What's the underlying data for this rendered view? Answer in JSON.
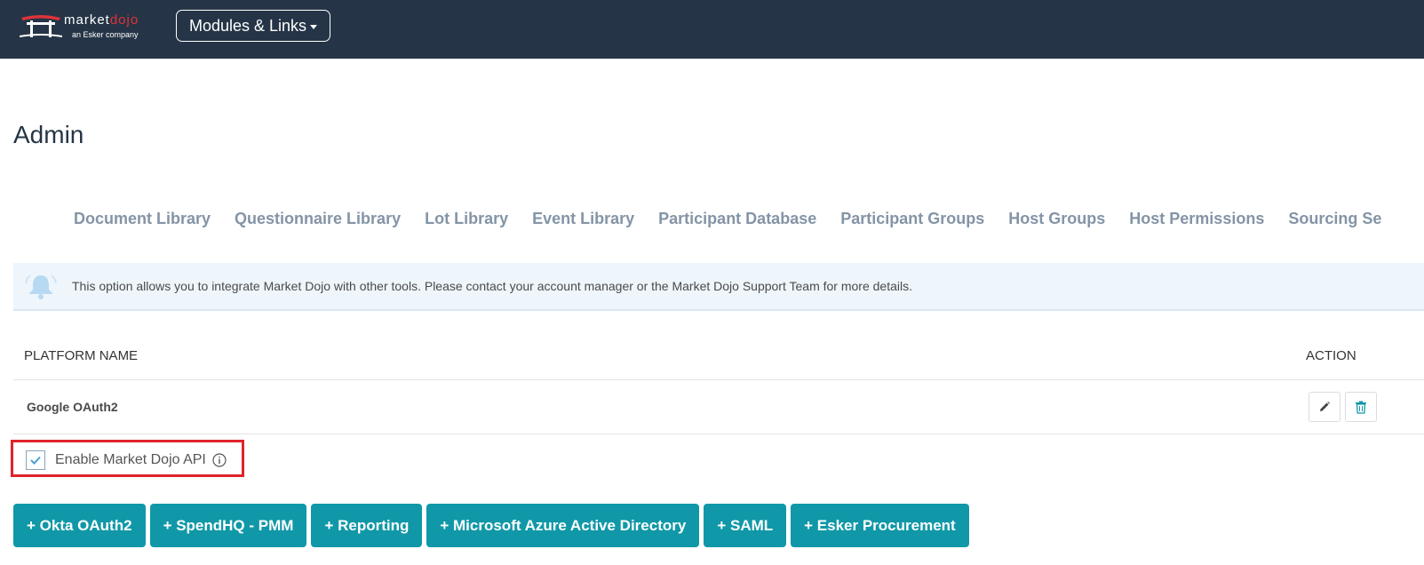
{
  "header": {
    "logo_brand_main": "market",
    "logo_brand_accent": "dojo",
    "logo_tagline": "an Esker company",
    "modules_label": "Modules & Links"
  },
  "page": {
    "title": "Admin"
  },
  "subnav": {
    "items": [
      "Document Library",
      "Questionnaire Library",
      "Lot Library",
      "Event Library",
      "Participant Database",
      "Participant Groups",
      "Host Groups",
      "Host Permissions",
      "Sourcing Se"
    ]
  },
  "alert": {
    "message": "This option allows you to integrate Market Dojo with other tools. Please contact your account manager or the Market Dojo Support Team for more details.",
    "icon": "bell-icon"
  },
  "table": {
    "headers": {
      "name": "PLATFORM NAME",
      "action": "ACTION"
    },
    "rows": [
      {
        "name": "Google OAuth2"
      }
    ]
  },
  "api_option": {
    "label": "Enable Market Dojo API",
    "checked": true
  },
  "add_buttons": [
    "+ Okta OAuth2",
    "+ SpendHQ - PMM",
    "+ Reporting",
    "+ Microsoft Azure Active Directory",
    "+ SAML",
    "+ Esker Procurement"
  ],
  "colors": {
    "navbar": "#253547",
    "accent": "#e0333a",
    "button": "#1098a8",
    "subnav_text": "#8494a6",
    "highlight_border": "#e0232b"
  }
}
